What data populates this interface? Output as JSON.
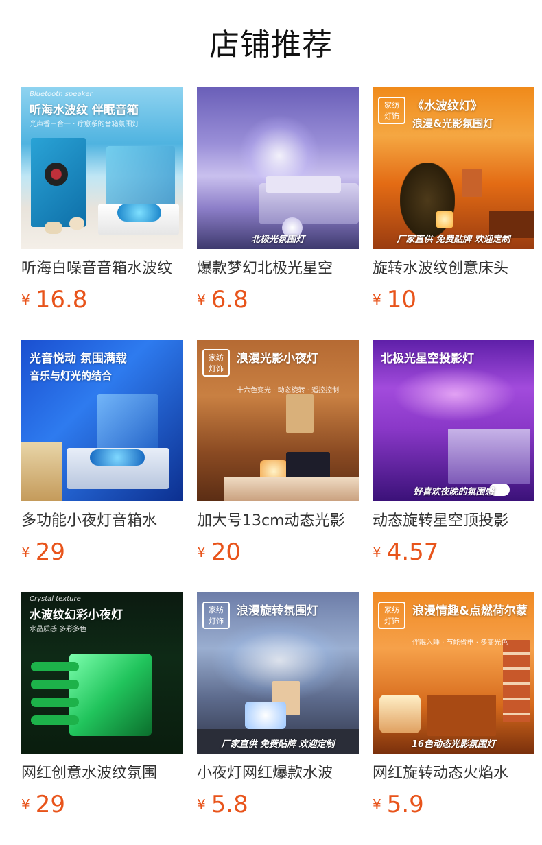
{
  "page": {
    "title": "店铺推荐"
  },
  "colors": {
    "price": "#e8541b",
    "title": "#111111"
  },
  "products": [
    {
      "name": "听海白噪音音箱水波纹",
      "currency": "¥",
      "price": "16.8",
      "img": {
        "hl1": "听海水波纹 伴眠音箱",
        "hl2": "",
        "hl3": "光声香三合一 · 疗愈系的音箱氛围灯",
        "tag": "",
        "bottom": "",
        "script": "Bluetooth speaker",
        "icon": "speaker-product-image"
      }
    },
    {
      "name": "爆款梦幻北极光星空",
      "currency": "¥",
      "price": "6.8",
      "img": {
        "hl1": "",
        "hl2": "",
        "hl3": "",
        "tag": "",
        "bottom": "北极光氛围灯",
        "script": "",
        "icon": "aurora-bedroom-image"
      }
    },
    {
      "name": "旋转水波纹创意床头",
      "currency": "¥",
      "price": "10",
      "img": {
        "hl1": "《水波纹灯》",
        "hl2": "浪漫&光影氛围灯",
        "hl3": "",
        "tag": "家纺\n灯饰",
        "bottom": "厂家直供 免费贴牌 欢迎定制",
        "script": "",
        "icon": "orange-room-image"
      }
    },
    {
      "name": "多功能小夜灯音箱水",
      "currency": "¥",
      "price": "29",
      "img": {
        "hl1": "光音悦动 氛围满载",
        "hl2": "音乐与灯光的结合",
        "hl3": "",
        "tag": "",
        "bottom": "",
        "script": "",
        "icon": "blue-speaker-image"
      }
    },
    {
      "name": "加大号13cm动态光影",
      "currency": "¥",
      "price": "20",
      "img": {
        "hl1": "浪漫光影小夜灯",
        "hl2": "",
        "hl3": "十六色变光 · 动态旋转 · 遥控控制",
        "tag": "家纺\n灯饰",
        "bottom": "",
        "script": "",
        "icon": "night-lamp-image"
      }
    },
    {
      "name": "动态旋转星空顶投影",
      "currency": "¥",
      "price": "4.57",
      "img": {
        "hl1": "北极光星空投影灯",
        "hl2": "",
        "hl3": "",
        "tag": "",
        "bottom": "好喜欢夜晚的氛围感",
        "script": "",
        "icon": "purple-room-image"
      }
    },
    {
      "name": "网红创意水波纹氛围",
      "currency": "¥",
      "price": "29",
      "img": {
        "hl1": "水波纹幻彩小夜灯",
        "hl2": "",
        "hl3": "水晶质感 多彩多色",
        "tag": "",
        "bottom": "",
        "script": "Crystal texture",
        "icon": "green-cube-image"
      }
    },
    {
      "name": "小夜灯网红爆款水波",
      "currency": "¥",
      "price": "5.8",
      "img": {
        "hl1": "浪漫旋转氛围灯",
        "hl2": "",
        "hl3": "",
        "tag": "家纺\n灯饰",
        "bottom": "厂家直供 免费贴牌 欢迎定制",
        "script": "",
        "icon": "blue-projection-image"
      }
    },
    {
      "name": "网红旋转动态火焰水",
      "currency": "¥",
      "price": "5.9",
      "img": {
        "hl1": "浪漫情趣&点燃荷尔蒙",
        "hl2": "",
        "hl3": "伴眠入睡 · 节能省电 · 多变光色",
        "tag": "家纺\n灯饰",
        "bottom": "16色动态光影氛围灯",
        "script": "",
        "icon": "flame-lamp-image"
      }
    }
  ]
}
